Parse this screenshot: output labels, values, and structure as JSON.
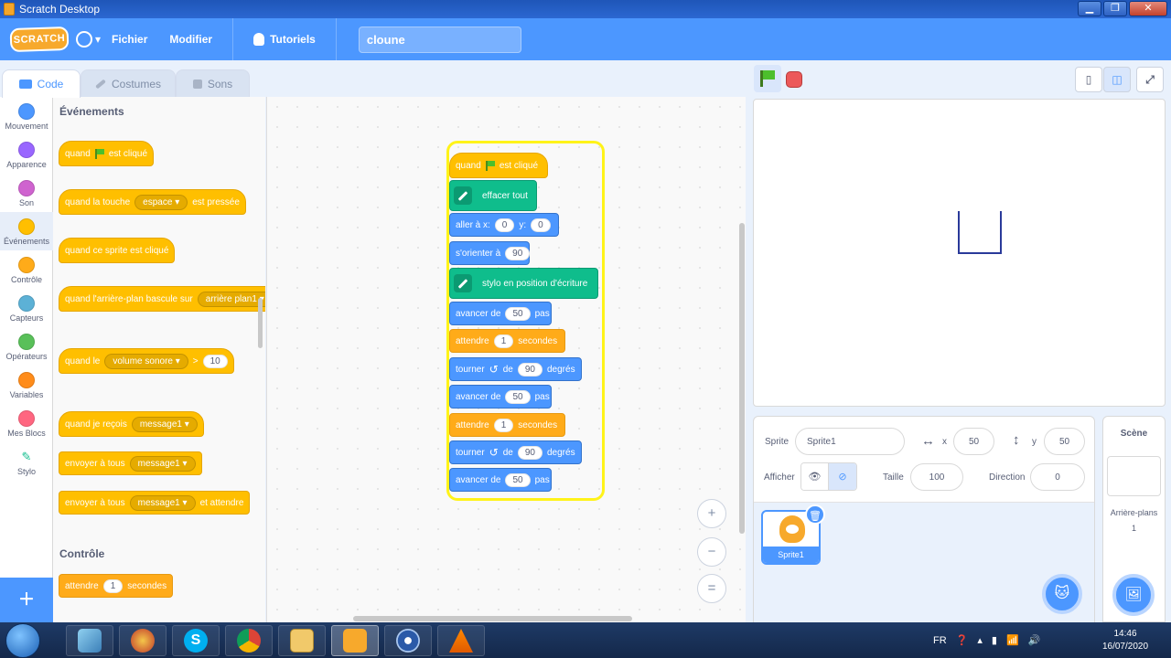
{
  "window": {
    "title": "Scratch Desktop"
  },
  "menubar": {
    "logo": "SCRATCH",
    "file": "Fichier",
    "edit": "Modifier",
    "tutorials": "Tutoriels",
    "project_name": "cloune"
  },
  "tabs": {
    "code": "Code",
    "costumes": "Costumes",
    "sounds": "Sons"
  },
  "categories": [
    {
      "label": "Mouvement",
      "color": "#4c97ff"
    },
    {
      "label": "Apparence",
      "color": "#9966ff"
    },
    {
      "label": "Son",
      "color": "#cf63cf"
    },
    {
      "label": "Événements",
      "color": "#ffbf00"
    },
    {
      "label": "Contrôle",
      "color": "#ffab19"
    },
    {
      "label": "Capteurs",
      "color": "#5cb1d6"
    },
    {
      "label": "Opérateurs",
      "color": "#59c059"
    },
    {
      "label": "Variables",
      "color": "#ff8c1a"
    },
    {
      "label": "Mes Blocs",
      "color": "#ff6680"
    },
    {
      "label": "Stylo",
      "color": "#0fbd8c"
    }
  ],
  "palette": {
    "events_title": "Événements",
    "control_title": "Contrôle",
    "when_flag_a": "quand",
    "when_flag_b": "est cliqué",
    "key_a": "quand la touche",
    "key_value": "espace",
    "key_b": "est pressée",
    "sprite_clicked": "quand ce sprite est cliqué",
    "backdrop_a": "quand l'arrière-plan bascule sur",
    "backdrop_value": "arrière plan1",
    "when_a": "quand le",
    "when_value": "volume sonore",
    "when_op": ">",
    "when_num": "10",
    "receive_a": "quand je reçois",
    "receive_value": "message1",
    "broadcast_a": "envoyer à tous",
    "broadcast_value": "message1",
    "broadcast_wait_a": "envoyer à tous",
    "broadcast_wait_value": "message1",
    "broadcast_wait_b": "et attendre",
    "wait_a": "attendre",
    "wait_value": "1",
    "wait_b": "secondes"
  },
  "script": {
    "hat_a": "quand",
    "hat_b": "est cliqué",
    "clear": "effacer tout",
    "goto_a": "aller à x:",
    "goto_x": "0",
    "goto_b": "y:",
    "goto_y": "0",
    "point_a": "s'orienter à",
    "point_value": "90",
    "pendown": "stylo en position d'écriture",
    "move1_a": "avancer de",
    "move1_value": "50",
    "move1_b": "pas",
    "wait1_a": "attendre",
    "wait1_value": "1",
    "wait1_b": "secondes",
    "turn1_a": "tourner",
    "turn1_c": "de",
    "turn1_value": "90",
    "turn1_b": "degrés",
    "move2_a": "avancer de",
    "move2_value": "50",
    "move2_b": "pas",
    "wait2_a": "attendre",
    "wait2_value": "1",
    "wait2_b": "secondes",
    "turn2_a": "tourner",
    "turn2_c": "de",
    "turn2_value": "90",
    "turn2_b": "degrés",
    "move3_a": "avancer de",
    "move3_value": "50",
    "move3_b": "pas"
  },
  "zoom": {
    "in": "+",
    "out": "−",
    "reset": "="
  },
  "sprite_info": {
    "sprite_label": "Sprite",
    "sprite_name": "Sprite1",
    "x_label": "x",
    "x_value": "50",
    "y_label": "y",
    "y_value": "50",
    "show_label": "Afficher",
    "size_label": "Taille",
    "size_value": "100",
    "direction_label": "Direction",
    "direction_value": "0",
    "thumb_label": "Sprite1"
  },
  "scene": {
    "title": "Scène",
    "backdrops_label": "Arrière-plans",
    "backdrops_count": "1"
  },
  "taskbar": {
    "lang": "FR",
    "time": "14:46",
    "date": "16/07/2020"
  }
}
